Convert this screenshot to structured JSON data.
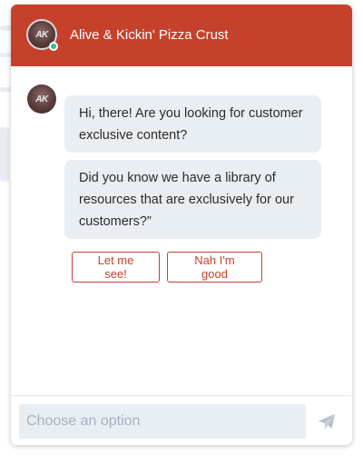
{
  "header": {
    "title": "Alive & Kickin' Pizza Crust",
    "avatar_initials": "AK",
    "status": "online",
    "background_color": "#c6412c"
  },
  "messages": [
    {
      "sender_avatar_initials": "AK",
      "text": "Hi, there! Are you looking for customer exclusive content?"
    },
    {
      "text": "Did you know we have a library of resources that are exclusively for our customers?”"
    }
  ],
  "options": [
    {
      "label": "Let me see!"
    },
    {
      "label": "Nah I'm good"
    }
  ],
  "composer": {
    "placeholder": "Choose an option",
    "send_icon": "paper-plane-icon"
  },
  "colors": {
    "accent": "#c6412c",
    "status_online": "#2fbf8f",
    "bubble_background": "#e9eef3"
  }
}
